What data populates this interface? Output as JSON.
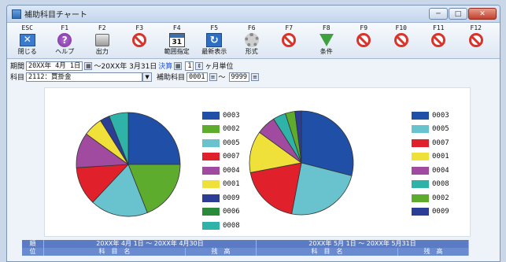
{
  "window": {
    "title": "補助科目チャート",
    "buttons": {
      "minimize": "─",
      "maximize": "□",
      "close": "✕"
    }
  },
  "toolbar": {
    "keys": [
      {
        "key": "ESC",
        "label": "閉じる",
        "icon": "close-window-icon",
        "kind": "close"
      },
      {
        "key": "F1",
        "label": "ヘルプ",
        "icon": "help-icon",
        "kind": "help"
      },
      {
        "key": "F2",
        "label": "出力",
        "icon": "printer-icon",
        "kind": "print"
      },
      {
        "key": "F3",
        "label": "",
        "icon": "no-icon",
        "kind": "no"
      },
      {
        "key": "F4",
        "label": "範囲指定",
        "icon": "calendar-icon",
        "kind": "cal",
        "glyph": "31"
      },
      {
        "key": "F5",
        "label": "最新表示",
        "icon": "refresh-icon",
        "kind": "refresh",
        "glyph": "↻"
      },
      {
        "key": "F6",
        "label": "形式",
        "icon": "gear-icon",
        "kind": "gear"
      },
      {
        "key": "F7",
        "label": "",
        "icon": "no-icon",
        "kind": "no"
      },
      {
        "key": "F8",
        "label": "条件",
        "icon": "filter-icon",
        "kind": "filter"
      },
      {
        "key": "F9",
        "label": "",
        "icon": "no-icon",
        "kind": "no"
      },
      {
        "key": "F10",
        "label": "",
        "icon": "no-icon",
        "kind": "no"
      },
      {
        "key": "F11",
        "label": "",
        "icon": "no-icon",
        "kind": "no"
      },
      {
        "key": "F12",
        "label": "",
        "icon": "no-icon",
        "kind": "no"
      }
    ]
  },
  "conditions": {
    "period_label": "期間",
    "period_from": "20XX年 4月 1日",
    "period_sep": "〜20XX年 3月31日",
    "settlement": "決算",
    "months_value": "1",
    "months_unit": "ヶ月単位",
    "account_label": "科目",
    "account_value": "2112：買掛金",
    "sub_label": "補助科目",
    "sub_from": "0001",
    "sub_sep": "〜",
    "sub_to": "9999"
  },
  "chart_data": [
    {
      "type": "pie",
      "title": "",
      "categories": [
        "0003",
        "0002",
        "0005",
        "0007",
        "0004",
        "0001",
        "0009",
        "0006",
        "0008"
      ],
      "values": [
        25,
        19,
        18,
        12,
        11,
        6,
        3,
        0,
        6
      ],
      "colors": [
        "#1f4fa6",
        "#5dac2e",
        "#68c3cf",
        "#e0202a",
        "#a04ba0",
        "#f0e03a",
        "#2b3d94",
        "#2a8a3a",
        "#2fb3a8"
      ]
    },
    {
      "type": "pie",
      "title": "",
      "categories": [
        "0003",
        "0005",
        "0007",
        "0001",
        "0004",
        "0008",
        "0002",
        "0009"
      ],
      "values": [
        29,
        24,
        19,
        13,
        6,
        4,
        3,
        2
      ],
      "colors": [
        "#1f4fa6",
        "#68c3cf",
        "#e0202a",
        "#f0e03a",
        "#a04ba0",
        "#2fb3a8",
        "#5dac2e",
        "#2b3d94"
      ]
    }
  ],
  "grid": {
    "row_header_top": "順",
    "row_header_bottom": "位",
    "period1": "20XX年 4月 1日 〜 20XX年 4月30日",
    "period2": "20XX年 5月 1日 〜 20XX年 5月31日",
    "col_account": "科　目　名",
    "col_balance": "残　高"
  }
}
